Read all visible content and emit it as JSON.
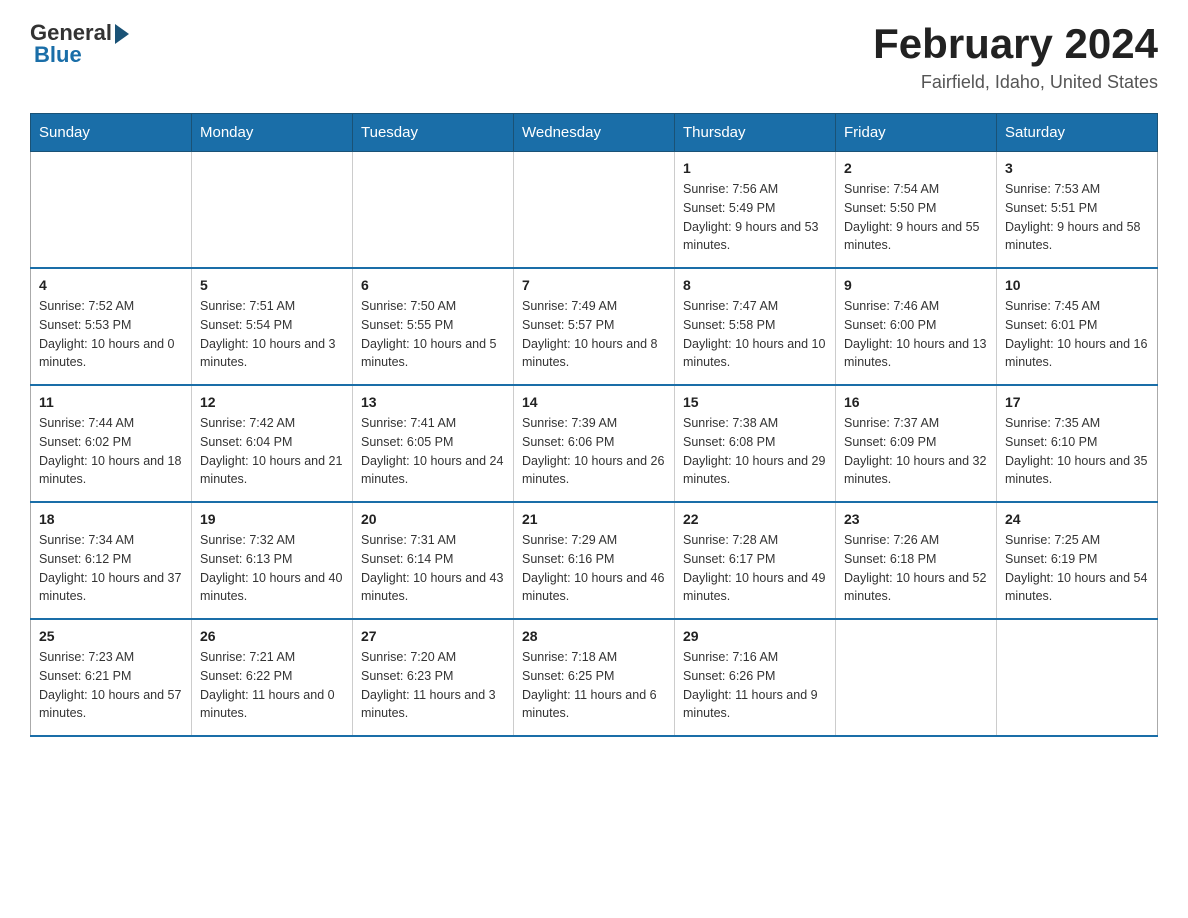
{
  "header": {
    "logo_general": "General",
    "logo_blue": "Blue",
    "month_title": "February 2024",
    "location": "Fairfield, Idaho, United States"
  },
  "days_of_week": [
    "Sunday",
    "Monday",
    "Tuesday",
    "Wednesday",
    "Thursday",
    "Friday",
    "Saturday"
  ],
  "weeks": [
    [
      {
        "day": "",
        "info": ""
      },
      {
        "day": "",
        "info": ""
      },
      {
        "day": "",
        "info": ""
      },
      {
        "day": "",
        "info": ""
      },
      {
        "day": "1",
        "info": "Sunrise: 7:56 AM\nSunset: 5:49 PM\nDaylight: 9 hours and 53 minutes."
      },
      {
        "day": "2",
        "info": "Sunrise: 7:54 AM\nSunset: 5:50 PM\nDaylight: 9 hours and 55 minutes."
      },
      {
        "day": "3",
        "info": "Sunrise: 7:53 AM\nSunset: 5:51 PM\nDaylight: 9 hours and 58 minutes."
      }
    ],
    [
      {
        "day": "4",
        "info": "Sunrise: 7:52 AM\nSunset: 5:53 PM\nDaylight: 10 hours and 0 minutes."
      },
      {
        "day": "5",
        "info": "Sunrise: 7:51 AM\nSunset: 5:54 PM\nDaylight: 10 hours and 3 minutes."
      },
      {
        "day": "6",
        "info": "Sunrise: 7:50 AM\nSunset: 5:55 PM\nDaylight: 10 hours and 5 minutes."
      },
      {
        "day": "7",
        "info": "Sunrise: 7:49 AM\nSunset: 5:57 PM\nDaylight: 10 hours and 8 minutes."
      },
      {
        "day": "8",
        "info": "Sunrise: 7:47 AM\nSunset: 5:58 PM\nDaylight: 10 hours and 10 minutes."
      },
      {
        "day": "9",
        "info": "Sunrise: 7:46 AM\nSunset: 6:00 PM\nDaylight: 10 hours and 13 minutes."
      },
      {
        "day": "10",
        "info": "Sunrise: 7:45 AM\nSunset: 6:01 PM\nDaylight: 10 hours and 16 minutes."
      }
    ],
    [
      {
        "day": "11",
        "info": "Sunrise: 7:44 AM\nSunset: 6:02 PM\nDaylight: 10 hours and 18 minutes."
      },
      {
        "day": "12",
        "info": "Sunrise: 7:42 AM\nSunset: 6:04 PM\nDaylight: 10 hours and 21 minutes."
      },
      {
        "day": "13",
        "info": "Sunrise: 7:41 AM\nSunset: 6:05 PM\nDaylight: 10 hours and 24 minutes."
      },
      {
        "day": "14",
        "info": "Sunrise: 7:39 AM\nSunset: 6:06 PM\nDaylight: 10 hours and 26 minutes."
      },
      {
        "day": "15",
        "info": "Sunrise: 7:38 AM\nSunset: 6:08 PM\nDaylight: 10 hours and 29 minutes."
      },
      {
        "day": "16",
        "info": "Sunrise: 7:37 AM\nSunset: 6:09 PM\nDaylight: 10 hours and 32 minutes."
      },
      {
        "day": "17",
        "info": "Sunrise: 7:35 AM\nSunset: 6:10 PM\nDaylight: 10 hours and 35 minutes."
      }
    ],
    [
      {
        "day": "18",
        "info": "Sunrise: 7:34 AM\nSunset: 6:12 PM\nDaylight: 10 hours and 37 minutes."
      },
      {
        "day": "19",
        "info": "Sunrise: 7:32 AM\nSunset: 6:13 PM\nDaylight: 10 hours and 40 minutes."
      },
      {
        "day": "20",
        "info": "Sunrise: 7:31 AM\nSunset: 6:14 PM\nDaylight: 10 hours and 43 minutes."
      },
      {
        "day": "21",
        "info": "Sunrise: 7:29 AM\nSunset: 6:16 PM\nDaylight: 10 hours and 46 minutes."
      },
      {
        "day": "22",
        "info": "Sunrise: 7:28 AM\nSunset: 6:17 PM\nDaylight: 10 hours and 49 minutes."
      },
      {
        "day": "23",
        "info": "Sunrise: 7:26 AM\nSunset: 6:18 PM\nDaylight: 10 hours and 52 minutes."
      },
      {
        "day": "24",
        "info": "Sunrise: 7:25 AM\nSunset: 6:19 PM\nDaylight: 10 hours and 54 minutes."
      }
    ],
    [
      {
        "day": "25",
        "info": "Sunrise: 7:23 AM\nSunset: 6:21 PM\nDaylight: 10 hours and 57 minutes."
      },
      {
        "day": "26",
        "info": "Sunrise: 7:21 AM\nSunset: 6:22 PM\nDaylight: 11 hours and 0 minutes."
      },
      {
        "day": "27",
        "info": "Sunrise: 7:20 AM\nSunset: 6:23 PM\nDaylight: 11 hours and 3 minutes."
      },
      {
        "day": "28",
        "info": "Sunrise: 7:18 AM\nSunset: 6:25 PM\nDaylight: 11 hours and 6 minutes."
      },
      {
        "day": "29",
        "info": "Sunrise: 7:16 AM\nSunset: 6:26 PM\nDaylight: 11 hours and 9 minutes."
      },
      {
        "day": "",
        "info": ""
      },
      {
        "day": "",
        "info": ""
      }
    ]
  ]
}
